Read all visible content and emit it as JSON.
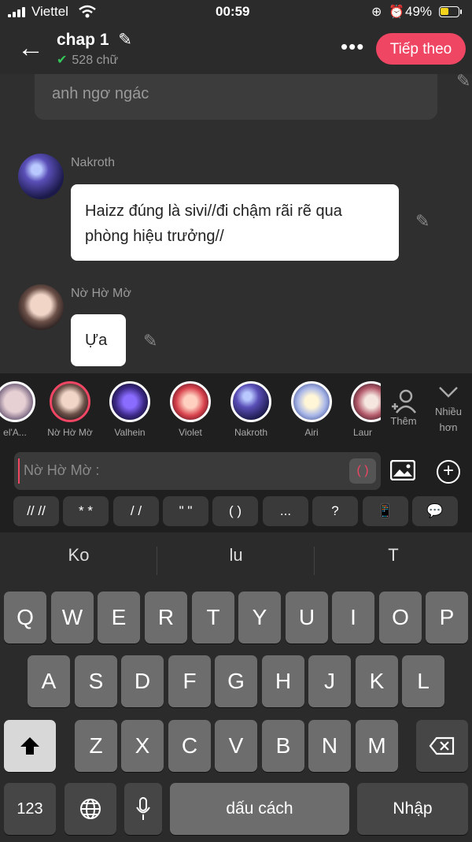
{
  "status": {
    "carrier": "Viettel",
    "time": "00:59",
    "battery": "49%",
    "battery_level": 0.49
  },
  "header": {
    "title": "chap 1",
    "word_count": "528 chữ",
    "next_label": "Tiếp theo"
  },
  "chat": {
    "prev_text": "anh ngơ ngác",
    "messages": [
      {
        "name": "Nakroth",
        "text": "Haizz đúng là sivi//đi chậm rãi rẽ qua phòng hiệu trưởng//"
      },
      {
        "name": "Nờ Hờ Mờ",
        "text": "Ựa"
      }
    ]
  },
  "characters": [
    {
      "label": "el'A..."
    },
    {
      "label": "Nờ Hờ Mờ"
    },
    {
      "label": "Valhein"
    },
    {
      "label": "Violet"
    },
    {
      "label": "Nakroth"
    },
    {
      "label": "Airi"
    },
    {
      "label": "Laur"
    }
  ],
  "strip_actions": {
    "add": "Thêm",
    "more": "Nhiều hơn"
  },
  "input": {
    "placeholder": "Nờ Hờ Mờ  :",
    "paren": "( )"
  },
  "shortcuts": [
    "// //",
    "* *",
    "/ /",
    "\" \"",
    "( )",
    "...",
    "?"
  ],
  "keyboard": {
    "suggestions": [
      "Ko",
      "lu",
      "T"
    ],
    "row1": [
      "Q",
      "W",
      "E",
      "R",
      "T",
      "Y",
      "U",
      "I",
      "O",
      "P"
    ],
    "row2": [
      "A",
      "S",
      "D",
      "F",
      "G",
      "H",
      "J",
      "K",
      "L"
    ],
    "row3": [
      "Z",
      "X",
      "C",
      "V",
      "B",
      "N",
      "M"
    ],
    "num": "123",
    "space": "dấu cách",
    "enter": "Nhập"
  }
}
